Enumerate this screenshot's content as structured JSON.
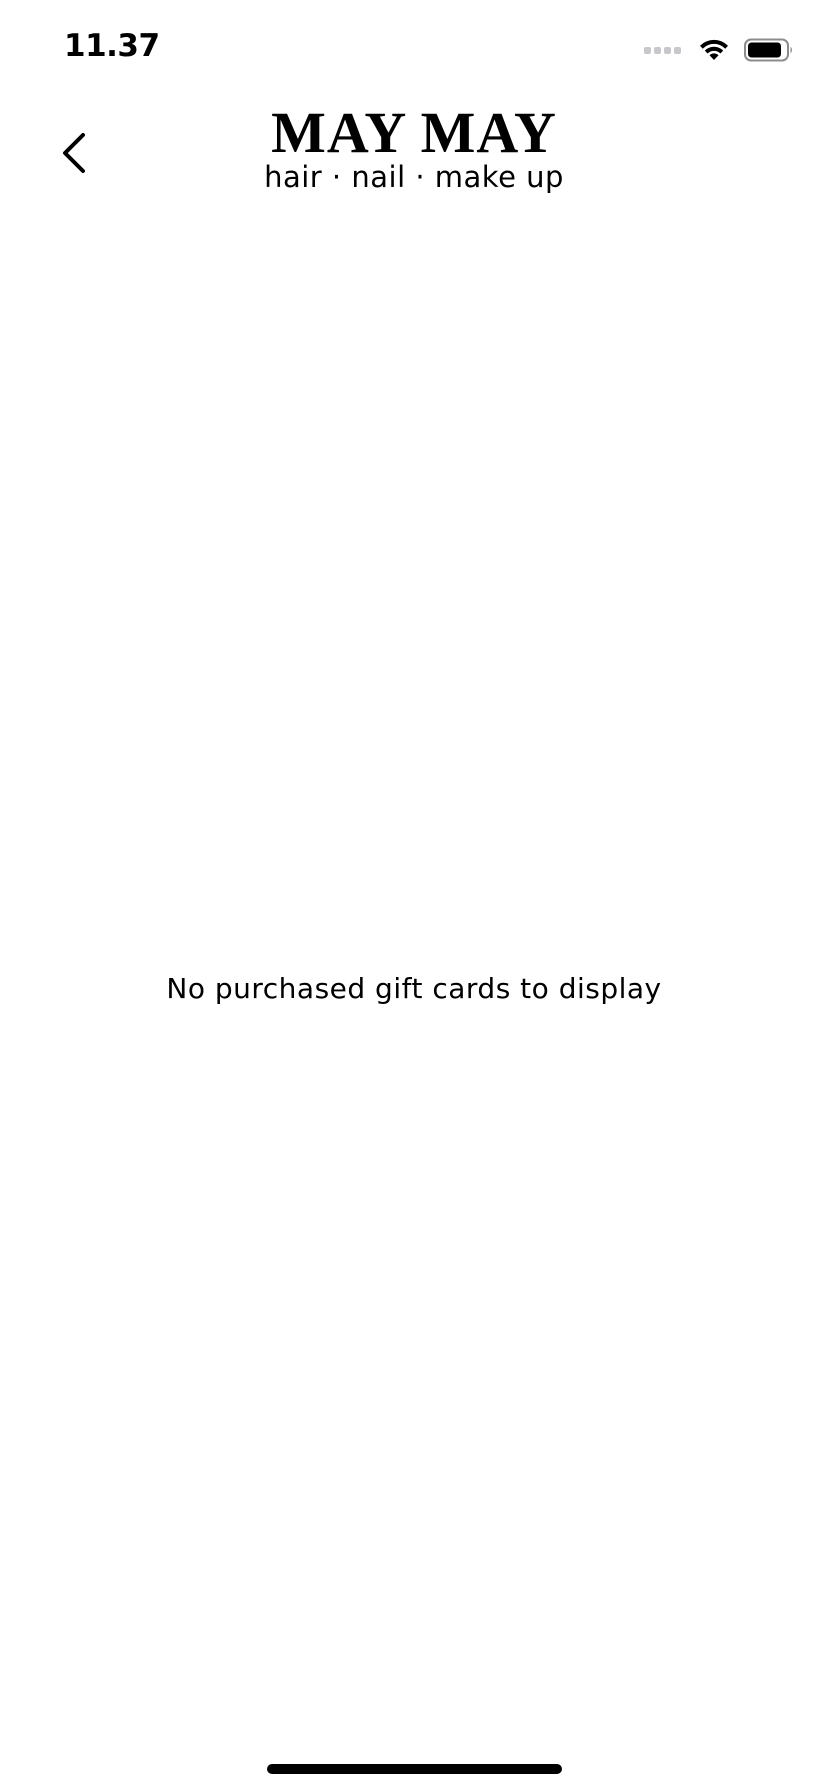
{
  "status_bar": {
    "time": "11.37",
    "icons": [
      "cellular-signal-icon",
      "wifi-icon",
      "battery-icon"
    ]
  },
  "nav": {
    "back_icon": "chevron-left-icon",
    "logo_title": "MAY MAY",
    "logo_tagline": "hair · nail · make up"
  },
  "content": {
    "empty_message": "No purchased gift cards to display"
  },
  "colors": {
    "background": "#ffffff",
    "text": "#000000",
    "inactive_signal": "#c7c7cc"
  }
}
